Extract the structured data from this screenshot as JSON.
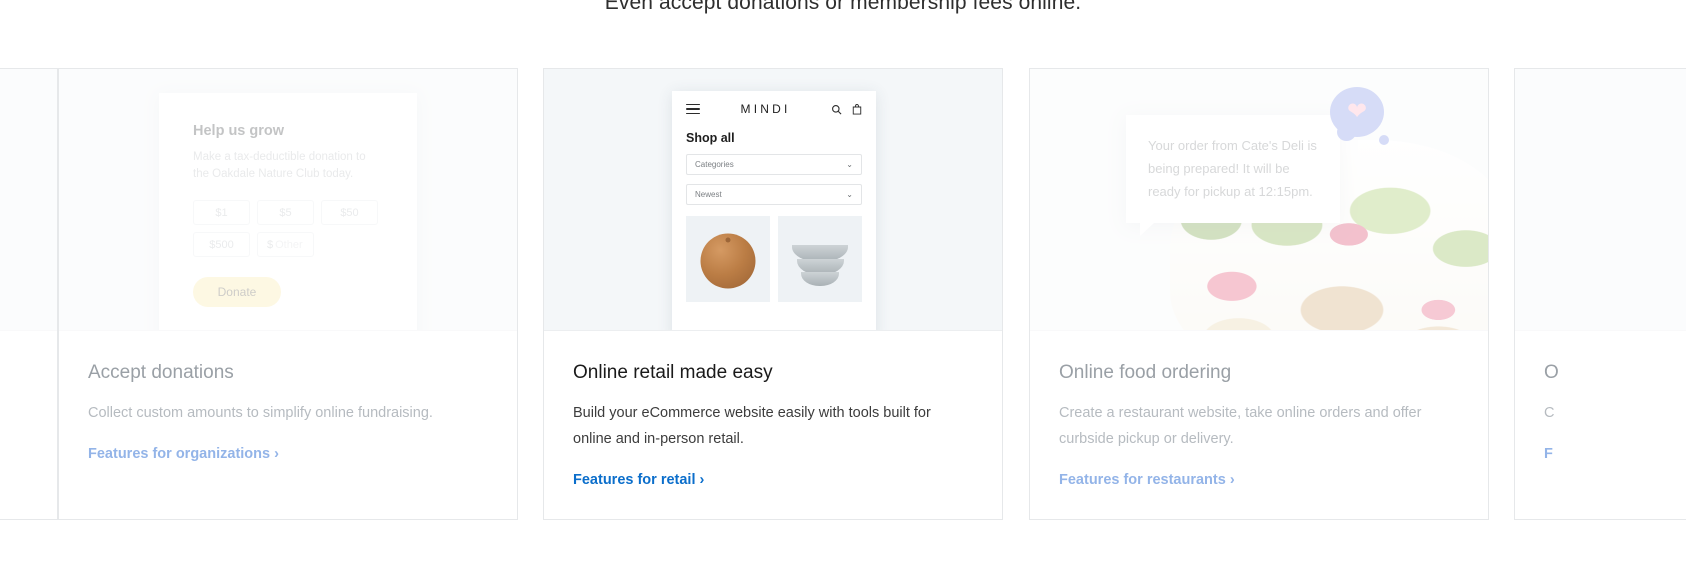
{
  "heading": "Even accept donations or membership fees online.",
  "cards": [
    {
      "title": "Accept donations",
      "desc": "Collect custom amounts to simplify online fundraising.",
      "link": "Features for organizations ›",
      "mock": {
        "title": "Help us grow",
        "subtitle": "Make a tax-deductible donation to the Oakdale Nature Club today.",
        "amounts": [
          "$1",
          "$5",
          "$50",
          "$500"
        ],
        "other_prefix": "$",
        "other_placeholder": "Other",
        "button": "Donate"
      }
    },
    {
      "title": "Online retail made easy",
      "desc": "Build your eCommerce website easily with tools built for online and in-person retail.",
      "link": "Features for retail ›",
      "mock": {
        "brand": "MINDI",
        "menu_icon": "hamburger-menu-icon",
        "search_icon": "search-icon",
        "bag_icon": "shopping-bag-icon",
        "section": "Shop all",
        "filters": [
          {
            "label": "Categories",
            "caret": "⌄"
          },
          {
            "label": "Newest",
            "caret": "⌄"
          }
        ],
        "products": [
          "wooden-ball-product",
          "stacked-bowls-product"
        ]
      }
    },
    {
      "title": "Online food ordering",
      "desc": "Create a restaurant website, take online orders and offer curbside pickup or delivery.",
      "link": "Features for restaurants ›",
      "mock": {
        "message": "Your order from Cate's Deli is being prepared! It will be ready for pickup at 12:15pm.",
        "heart_icon": "heart-icon",
        "bubble_color": "#7b8fe8",
        "heart_color": "#ffb3c7"
      }
    },
    {
      "title": "O",
      "desc": "C",
      "link": "F"
    }
  ],
  "colors": {
    "active_link": "#0b6ecb",
    "faded_link": "#93b4e8",
    "donate_button": "#fbeaa4",
    "card_border": "#e6e8ea"
  }
}
